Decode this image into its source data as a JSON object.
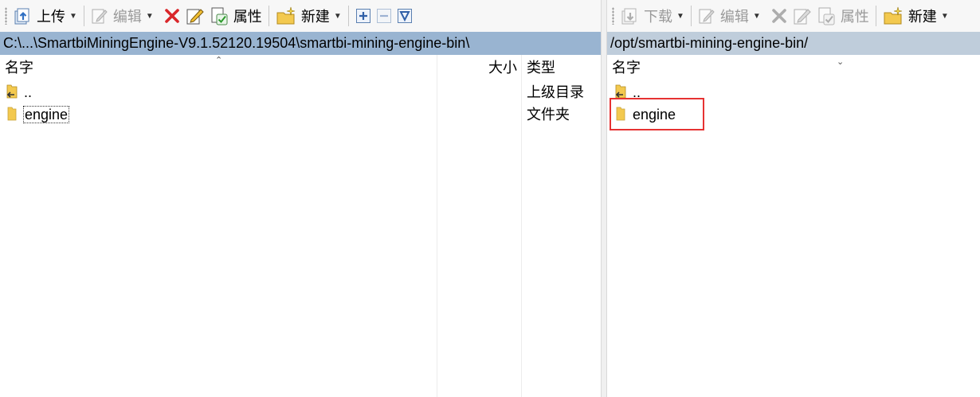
{
  "left_pane": {
    "toolbar": {
      "upload_label": "上传",
      "edit_label": "编辑",
      "properties_label": "属性",
      "new_label": "新建"
    },
    "path": "C:\\...\\SmartbiMiningEngine-V9.1.52120.19504\\smartbi-mining-engine-bin\\",
    "columns": {
      "name": "名字",
      "size": "大小",
      "type": "类型"
    },
    "rows": [
      {
        "name": "..",
        "size": "",
        "type": "上级目录",
        "icon": "parent-folder-icon"
      },
      {
        "name": "engine",
        "size": "",
        "type": "文件夹",
        "icon": "folder-icon"
      }
    ]
  },
  "right_pane": {
    "toolbar": {
      "download_label": "下载",
      "edit_label": "编辑",
      "properties_label": "属性",
      "new_label": "新建"
    },
    "path": "/opt/smartbi-mining-engine-bin/",
    "columns": {
      "name": "名字"
    },
    "rows": [
      {
        "name": "..",
        "icon": "parent-folder-icon"
      },
      {
        "name": "engine",
        "icon": "folder-icon",
        "highlighted": true
      }
    ]
  },
  "colors": {
    "active_path_bg": "#99b4d1",
    "inactive_path_bg": "#bfcddb",
    "highlight_box": "#e63232",
    "folder_yellow": "#f3c94f"
  }
}
